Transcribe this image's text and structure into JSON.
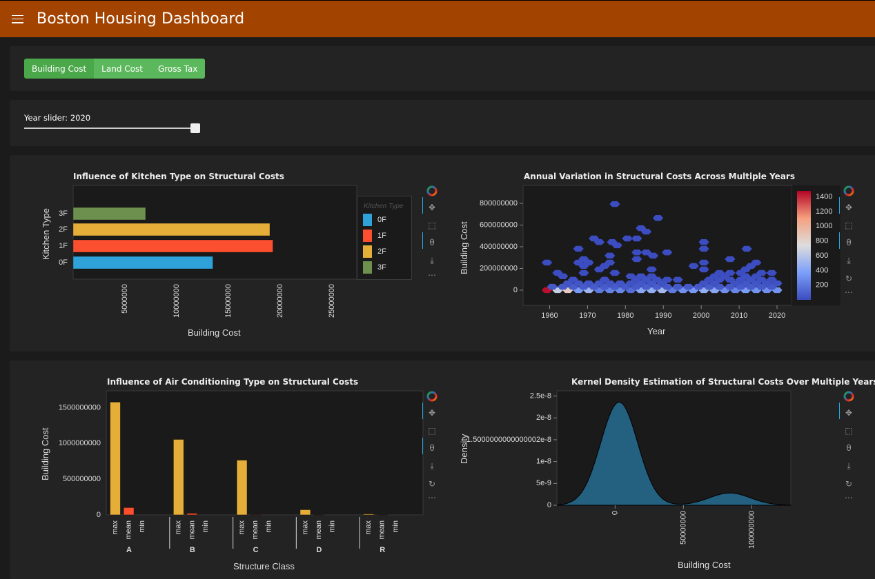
{
  "header": {
    "title": "Boston Housing Dashboard",
    "menu_icon": "hamburger-menu-icon",
    "color": "#a34300"
  },
  "metric_buttons": [
    {
      "label": "Building Cost",
      "active": true
    },
    {
      "label": "Land Cost",
      "active": false
    },
    {
      "label": "Gross Tax",
      "active": false
    }
  ],
  "slider": {
    "label": "Year slider: 2020",
    "value": 2020,
    "fraction": 1.0
  },
  "toolbar": {
    "icons": [
      "bokeh-logo-icon",
      "pan-icon",
      "box-zoom-icon",
      "wheel-zoom-icon",
      "save-icon",
      "reset-icon",
      "more-icon"
    ]
  },
  "chart_data": [
    {
      "type": "bar",
      "orientation": "horizontal",
      "title": "Influence of Kitchen Type on Structural Costs",
      "xlabel": "Building Cost",
      "ylabel": "Kitchen Type",
      "categories": [
        "0F",
        "1F",
        "2F",
        "3F"
      ],
      "values": [
        13500000,
        19300000,
        19000000,
        7000000
      ],
      "colors": [
        "#30a2da",
        "#fc4f30",
        "#e5ae38",
        "#6d904f"
      ],
      "xlim": [
        0,
        27400000
      ],
      "xticks": [
        5000000,
        10000000,
        15000000,
        20000000,
        25000000
      ],
      "xtick_labels": [
        "5000000",
        "10000000",
        "15000000",
        "20000000",
        "25000000"
      ],
      "legend": {
        "title": "Kitchen Type",
        "entries": [
          "0F",
          "1F",
          "2F",
          "3F"
        ],
        "placement": "right"
      }
    },
    {
      "type": "heatmap",
      "subtype": "hexbin",
      "title": "Annual Variation in Structural Costs Across Multiple Years",
      "xlabel": "Year",
      "ylabel": "Building Cost",
      "xlim": [
        1953,
        2024
      ],
      "ylim": [
        -140000000,
        965000000
      ],
      "xticks": [
        1960,
        1970,
        1980,
        1990,
        2000,
        2010,
        2020
      ],
      "yticks": [
        0,
        200000000,
        400000000,
        600000000,
        800000000
      ],
      "ytick_labels": [
        "0",
        "200000000",
        "400000000",
        "600000000",
        "800000000"
      ],
      "colorbar": {
        "ticks": [
          200,
          400,
          600,
          800,
          1000,
          1200,
          1400
        ],
        "range": [
          1,
          1480
        ],
        "colormap": "coolwarm"
      },
      "cells": [
        [
          1959.3,
          0,
          1450
        ],
        [
          1962.1,
          0,
          650
        ],
        [
          1964.8,
          0,
          850
        ],
        [
          1967.6,
          0,
          350
        ],
        [
          1970.3,
          0,
          500
        ],
        [
          1973.1,
          0,
          200
        ],
        [
          1975.9,
          0,
          240
        ],
        [
          1978.6,
          0,
          260
        ],
        [
          1981.4,
          0,
          150
        ],
        [
          1984.1,
          0,
          420
        ],
        [
          1986.9,
          0,
          460
        ],
        [
          1989.7,
          0,
          520
        ],
        [
          1992.4,
          0,
          200
        ],
        [
          1995.2,
          0,
          300
        ],
        [
          1997.9,
          0,
          340
        ],
        [
          2000.7,
          0,
          460
        ],
        [
          2003.5,
          0,
          420
        ],
        [
          2006.2,
          0,
          300
        ],
        [
          2009,
          0,
          260
        ],
        [
          2011.7,
          0,
          360
        ],
        [
          2014.5,
          0,
          320
        ],
        [
          2017.3,
          0,
          300
        ],
        [
          2020,
          0,
          320
        ],
        [
          1960.7,
          31,
          60
        ],
        [
          1963.5,
          31,
          60
        ],
        [
          1966.2,
          31,
          70
        ],
        [
          1969,
          31,
          70
        ],
        [
          1971.7,
          31,
          70
        ],
        [
          1974.5,
          31,
          70
        ],
        [
          1977.2,
          31,
          70
        ],
        [
          1980,
          31,
          60
        ],
        [
          1982.8,
          31,
          60
        ],
        [
          1985.5,
          31,
          80
        ],
        [
          1988.3,
          31,
          80
        ],
        [
          1991,
          31,
          60
        ],
        [
          1993.8,
          31,
          60
        ],
        [
          1996.6,
          31,
          60
        ],
        [
          1999.3,
          31,
          60
        ],
        [
          2002.1,
          31,
          70
        ],
        [
          2004.8,
          31,
          60
        ],
        [
          2007.6,
          31,
          60
        ],
        [
          2010.4,
          31,
          70
        ],
        [
          2013.1,
          31,
          70
        ],
        [
          2015.9,
          31,
          60
        ],
        [
          2018.6,
          31,
          60
        ],
        [
          1964.8,
          63,
          40
        ],
        [
          1967.6,
          63,
          40
        ],
        [
          1970.3,
          63,
          40
        ],
        [
          1973.1,
          63,
          40
        ],
        [
          1975.9,
          63,
          40
        ],
        [
          1978.6,
          63,
          40
        ],
        [
          1981.4,
          63,
          30
        ],
        [
          1984.1,
          63,
          50
        ],
        [
          1986.9,
          63,
          50
        ],
        [
          1989.7,
          63,
          30
        ],
        [
          2000.7,
          63,
          30
        ],
        [
          2003.5,
          63,
          30
        ],
        [
          2009,
          63,
          30
        ],
        [
          2011.7,
          63,
          50
        ],
        [
          2014.5,
          63,
          40
        ],
        [
          2017.3,
          63,
          30
        ],
        [
          2020,
          63,
          30
        ],
        [
          1966.2,
          96,
          20
        ],
        [
          1974.5,
          96,
          20
        ],
        [
          1982.8,
          96,
          20
        ],
        [
          1985.5,
          96,
          30
        ],
        [
          1988.3,
          96,
          20
        ],
        [
          1991,
          96,
          10
        ],
        [
          1993.8,
          96,
          10
        ],
        [
          2002.1,
          96,
          10
        ],
        [
          2004.8,
          96,
          20
        ],
        [
          2007.6,
          96,
          10
        ],
        [
          2010.4,
          96,
          20
        ],
        [
          2013.1,
          96,
          30
        ],
        [
          2015.9,
          96,
          20
        ],
        [
          2018.6,
          96,
          10
        ],
        [
          1981.4,
          128,
          10
        ],
        [
          1984.1,
          128,
          20
        ],
        [
          1986.9,
          128,
          10
        ],
        [
          2003.5,
          128,
          10
        ],
        [
          2006.2,
          128,
          10
        ],
        [
          2011.7,
          128,
          20
        ],
        [
          2014.5,
          128,
          10
        ],
        [
          1962.1,
          159,
          5
        ],
        [
          1969,
          159,
          5
        ],
        [
          1977.2,
          159,
          5
        ],
        [
          2004.8,
          159,
          5
        ],
        [
          2007.6,
          159,
          5
        ],
        [
          2010.4,
          159,
          5
        ],
        [
          2015.9,
          159,
          5
        ],
        [
          2018.6,
          159,
          5
        ],
        [
          1963.5,
          128,
          5
        ],
        [
          1986.9,
          191,
          5
        ],
        [
          1973.1,
          191,
          5
        ],
        [
          1998,
          223,
          5
        ],
        [
          2000.7,
          191,
          5
        ],
        [
          2011.7,
          191,
          5
        ],
        [
          2013.1,
          223,
          5
        ],
        [
          1959.3,
          254,
          5
        ],
        [
          1967.6,
          254,
          5
        ],
        [
          1970.3,
          254,
          5
        ],
        [
          1975.9,
          254,
          5
        ],
        [
          1969,
          223,
          5
        ],
        [
          1974.5,
          223,
          5
        ],
        [
          2000.7,
          254,
          5
        ],
        [
          2014.5,
          254,
          5
        ],
        [
          1969,
          286,
          5
        ],
        [
          1983,
          286,
          5
        ],
        [
          2007.6,
          286,
          5
        ],
        [
          1975.9,
          318,
          5
        ],
        [
          1987.3,
          318,
          5
        ],
        [
          1983,
          348,
          5
        ],
        [
          1985.5,
          348,
          5
        ],
        [
          1991,
          348,
          5
        ],
        [
          1967.6,
          381,
          5
        ],
        [
          2000.7,
          381,
          5
        ],
        [
          2012,
          381,
          5
        ],
        [
          1977.8,
          413,
          5
        ],
        [
          1973.1,
          443,
          5
        ],
        [
          1976.5,
          443,
          5
        ],
        [
          2000.7,
          443,
          5
        ],
        [
          1971.7,
          476,
          5
        ],
        [
          1980.5,
          476,
          5
        ],
        [
          1983,
          476,
          5
        ],
        [
          1985.5,
          539,
          5
        ],
        [
          1984.1,
          571,
          5
        ],
        [
          1988.6,
          665,
          5
        ],
        [
          1977.2,
          793,
          5
        ]
      ]
    },
    {
      "type": "bar",
      "orientation": "vertical",
      "subtype": "grouped",
      "title": "Influence of Air Conditioning Type on Structural Costs",
      "xlabel": "Structure Class",
      "ylabel": "Building Cost",
      "categories": [
        "A",
        "B",
        "C",
        "D",
        "R"
      ],
      "subcategories": [
        "max",
        "mean",
        "min"
      ],
      "series": [
        {
          "name": "max",
          "color": "#e5ae38",
          "values": [
            1578000000,
            1056000000,
            766000000,
            73000000,
            13000000
          ]
        },
        {
          "name": "mean",
          "color": "#fc4f30",
          "values": [
            103000000,
            22000000,
            3000000,
            1000000,
            500000
          ]
        },
        {
          "name": "min",
          "color": "#6d904f",
          "values": [
            0,
            0,
            0,
            0,
            0
          ]
        }
      ],
      "ylim": [
        0,
        1735000000
      ],
      "yticks": [
        0,
        500000000,
        1000000000,
        1500000000
      ],
      "ytick_labels": [
        "0",
        "500000000",
        "1000000000",
        "1500000000"
      ]
    },
    {
      "type": "area",
      "subtype": "kde",
      "title": "Kernel Density Estimation of Structural Costs Over Multiple Years",
      "xlabel": "Building Cost",
      "ylabel": "Density",
      "xlim": [
        -42600000,
        128600000
      ],
      "ylim": [
        0,
        2.62e-08
      ],
      "xticks": [
        0,
        50000000,
        100000000
      ],
      "xtick_labels": [
        "0",
        "50000000",
        "100000000"
      ],
      "yticks": [
        0,
        5e-09,
        1e-08,
        1.5e-08,
        2e-08,
        2.5e-08
      ],
      "ytick_labels": [
        "0",
        "5e-9",
        "1e-8",
        "1.5000000000000002e-8",
        "2e-8",
        "2.5e-8"
      ],
      "fill_color": "#24607f",
      "components": [
        {
          "mean": 3000000,
          "sd": 13500000,
          "peak": 2.36e-08
        },
        {
          "mean": 84000000,
          "sd": 15000000,
          "peak": 2.8e-09
        }
      ]
    }
  ]
}
